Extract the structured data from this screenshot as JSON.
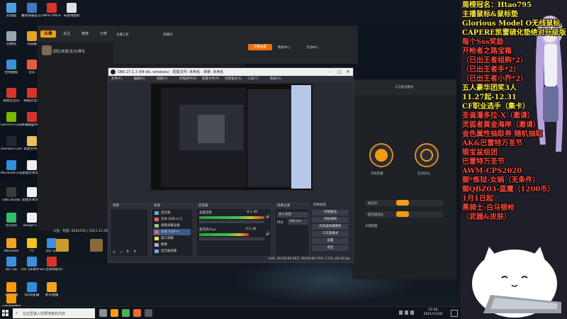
{
  "desktop": {
    "icons": [
      {
        "label": "此电脑",
        "color": "#4aa3df"
      },
      {
        "label": "魔兽争霸官方对战平台",
        "color": "#3c7bbf"
      },
      {
        "label": "WPS Office",
        "color": "#d9342b"
      },
      {
        "label": "未使用图标",
        "color": "#e0e0e0"
      },
      {
        "label": "回收站",
        "color": "#9aa7b2"
      },
      {
        "label": "浏览器",
        "color": "#e5a323"
      },
      {
        "label": "控制面板",
        "color": "#3a8fd5"
      },
      {
        "label": "音乐",
        "color": "#e55b3c"
      },
      {
        "label": "网易云音乐",
        "color": "#d9342b"
      },
      {
        "label": "GeForce Experience",
        "color": "#76b900"
      },
      {
        "label": "网络云音乐",
        "color": "#d9342b"
      },
      {
        "label": "Glorious Core",
        "color": "#222831"
      },
      {
        "label": "英雄联盟WeGame",
        "color": "#d9342b"
      },
      {
        "label": "Microsoft Edge",
        "color": "#2f8fd8"
      },
      {
        "label": "新建文件夹",
        "color": "#e7c35a"
      },
      {
        "label": "OBS Studio",
        "color": "#3a3a3a"
      },
      {
        "label": "新建文本文档",
        "color": "#f0f0f0"
      },
      {
        "label": "QQ音乐",
        "color": "#2fbf6b"
      },
      {
        "label": "新建文本文档",
        "color": "#f0f0f0"
      },
      {
        "label": "WeGame",
        "color": "#f3a21b"
      },
      {
        "label": "Bongo Cat",
        "color": "#f0f0f0"
      },
      {
        "label": "QQ飞车",
        "color": "#3d8de0"
      },
      {
        "label": "YY",
        "color": "#f3c51b"
      },
      {
        "label": "QQ飞车",
        "color": "#3d8de0"
      },
      {
        "label": "Steam",
        "color": "#1b2838"
      },
      {
        "label": "斗鱼直播",
        "color": "#f39c12"
      },
      {
        "label": "QQ飞车助手工具",
        "color": "#3d8de0"
      },
      {
        "label": "CF活动领取大助手",
        "color": "#d9342b"
      },
      {
        "label": "斗鱼直播伴侣",
        "color": "#f39c12"
      },
      {
        "label": "QQ浏览器",
        "color": "#2f8fd8"
      },
      {
        "label": "虎牙直播",
        "color": "#f3a21b"
      }
    ]
  },
  "live_app": {
    "tabs": [
      "关注",
      "推荐",
      "分类",
      "直播"
    ],
    "user_line": "回忆/实验/主分/排位",
    "live_button": "开播",
    "stats": "斗鱼 · 热度: 8282155 | 2021.11.28"
  },
  "browser_strip": {
    "tab_label": "开播设置",
    "labels": [
      "主播工具",
      "直播间",
      "数据中心",
      "活动中心"
    ]
  },
  "live_panel": {
    "header": "三方推流模式",
    "circle_left": "开始直播",
    "circle_right": "互动玩法",
    "row_text": [
      "第二方推流直播",
      "第三方推流直播",
      "推流码",
      "服务器地址",
      "开播提醒"
    ]
  },
  "obs": {
    "title": "OBS 27.1.3 (64-bit, windows) - 配置文件: 未命名 - 场景: 未命名",
    "menu": [
      "文件(F)",
      "编辑(E)",
      "视图(V)",
      "停靠部件(D)",
      "配置文件(P)",
      "场景集合(S)",
      "工具(T)",
      "帮助(H)"
    ],
    "scenes_title": "场景",
    "sources_title": "来源",
    "mixer_title": "混音器",
    "transitions_title": "场景过渡",
    "controls_title": "控制按钮",
    "sources": [
      {
        "name": "显示器",
        "icon_color": "#6fa8dc",
        "selected": false
      },
      {
        "name": "文本 (GDI+) 2",
        "icon_color": "#e06666",
        "selected": false
      },
      {
        "name": "视频采集设备",
        "icon_color": "#93c47d",
        "selected": false
      },
      {
        "name": "文本 (GDI+)",
        "icon_color": "#e06666",
        "selected": true
      },
      {
        "name": "窗口采集",
        "icon_color": "#ffd966",
        "selected": false
      },
      {
        "name": "图像",
        "icon_color": "#b4a7d6",
        "selected": false
      },
      {
        "name": "显示器采集",
        "icon_color": "#6fa8dc",
        "selected": false
      }
    ],
    "mixer_channels": [
      "桌面音频",
      "麦克风/Aux"
    ],
    "mixer_db": [
      "-8.2 dB",
      "0.0 dB"
    ],
    "transition_value": "淡入淡出",
    "duration_label": "时长",
    "duration_value": "300 ms",
    "controls": [
      "开始推流",
      "开始录制",
      "启动虚拟摄像机",
      "工作室模式",
      "设置",
      "退出"
    ],
    "status": "LIVE: 00:00:00  REC: 00:00:00  CPU: 2.3%, 60.00 fps"
  },
  "overlay": {
    "lines": [
      {
        "text": "周榜冠名：Htao795",
        "color": "yellow"
      },
      {
        "text": "主播鼠标&鼠标垫",
        "color": "yellow"
      },
      {
        "text": "Glorious Model O无线鼠标",
        "color": "yellow"
      },
      {
        "text": "CAPERE凯雷硫化垫绝对升级版",
        "color": "yellow"
      },
      {
        "text": "每个Sss奖励",
        "color": "red"
      },
      {
        "text": "开枪者之路宝箱",
        "color": "red"
      },
      {
        "text": "（已出王者组购*2）",
        "color": "red"
      },
      {
        "text": "（已出王者手*2）",
        "color": "red"
      },
      {
        "text": "（已出王者小乔*2）",
        "color": "red"
      },
      {
        "text": "五人豪华团奖3人",
        "color": "yellow"
      },
      {
        "text": "11.27起-12.31",
        "color": "yellow"
      },
      {
        "text": "CF职业选手（集卡）",
        "color": "yellow"
      },
      {
        "text": "圣诞潘多拉-X（邀请）",
        "color": "red"
      },
      {
        "text": "灵狐者黄金海岸（邀请）",
        "color": "red"
      },
      {
        "text": "金色属性抽取券 随机抽取",
        "color": "red"
      },
      {
        "text": "AK&巴雷特万圣节",
        "color": "red"
      },
      {
        "text": "锻宝盆组团",
        "color": "red"
      },
      {
        "text": "巴雷特万圣节",
        "color": "red"
      },
      {
        "text": "AWM-CPS2020",
        "color": "red"
      },
      {
        "text": "御*炼狱-女娲（无条件）",
        "color": "red"
      },
      {
        "text": "御QBZ03-蓝鹰（1200币）",
        "color": "red"
      },
      {
        "text": "1月1日起",
        "color": "red"
      },
      {
        "text": "黑骑士-白马银枪",
        "color": "red"
      },
      {
        "text": "（武器&皮肤）",
        "color": "red"
      }
    ]
  },
  "taskbar": {
    "search_placeholder": "在这里输入你要搜索的内容",
    "time": "23:18",
    "date": "2021/11/28",
    "apps": [
      {
        "name": "task-view",
        "color": "#8a8f99"
      },
      {
        "name": "douyu",
        "color": "#f39c12"
      },
      {
        "name": "chrome",
        "color": "#4caf50"
      },
      {
        "name": "douyu-live",
        "color": "#e76f2d"
      },
      {
        "name": "obs",
        "color": "#555a66"
      }
    ]
  }
}
